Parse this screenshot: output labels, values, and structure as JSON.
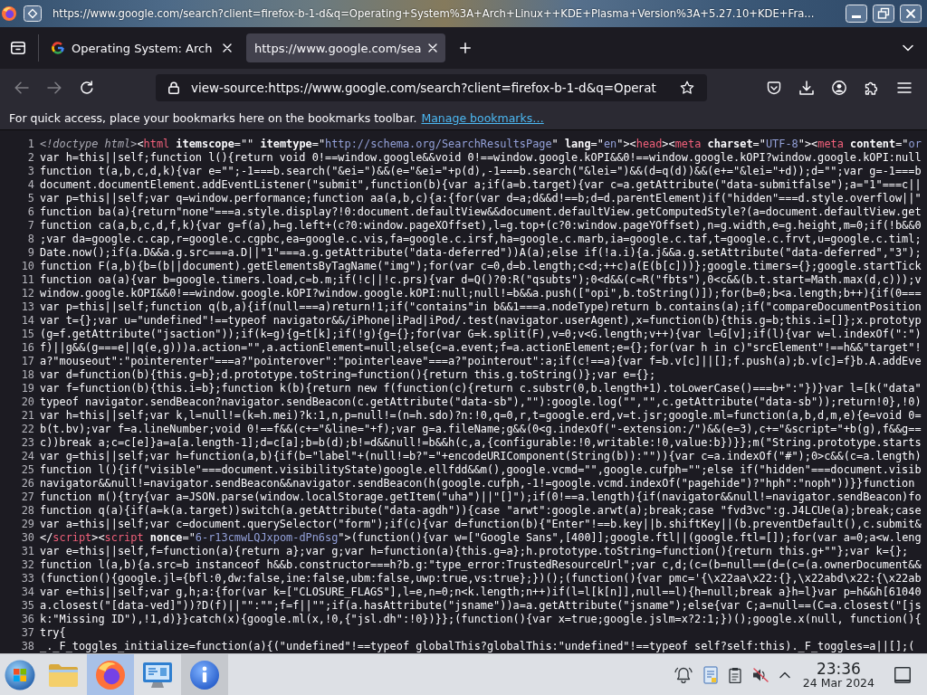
{
  "window": {
    "title": "https://www.google.com/search?client=firefox-b-1-d&q=Operating+System%3A+Arch+Linux++KDE+Plasma+Version%3A+5.27.10+KDE+Fra..."
  },
  "tabs": [
    {
      "label": "Operating System: Arch",
      "favicon": true,
      "selected": false
    },
    {
      "label": "https://www.google.com/sea",
      "favicon": false,
      "selected": true
    }
  ],
  "nav_buttons": [
    {
      "kind": "back",
      "disabled": true
    },
    {
      "kind": "forward",
      "disabled": true
    },
    {
      "kind": "reload",
      "disabled": false
    }
  ],
  "address_bar": {
    "value": "view-source:https://www.google.com/search?client=firefox-b-1-d&q=Operat"
  },
  "bookmarks_bar": {
    "message": "For quick access, place your bookmarks here on the bookmarks toolbar.",
    "link": "Manage bookmarks…"
  },
  "source": {
    "lines": [
      {
        "number": "1",
        "tokens": [
          {
            "kind": "doctype",
            "text": "<!doctype html>"
          },
          {
            "kind": "text",
            "text": "<"
          },
          {
            "kind": "tag",
            "text": "html"
          },
          {
            "kind": "attr",
            "text": " itemscope"
          },
          {
            "kind": "text",
            "text": "=\"\" "
          },
          {
            "kind": "attr",
            "text": "itemtype"
          },
          {
            "kind": "text",
            "text": "=\""
          },
          {
            "kind": "value",
            "text": "http://schema.org/SearchResultsPage"
          },
          {
            "kind": "text",
            "text": "\" "
          },
          {
            "kind": "attr",
            "text": "lang"
          },
          {
            "kind": "text",
            "text": "=\""
          },
          {
            "kind": "value",
            "text": "en"
          },
          {
            "kind": "text",
            "text": "\"><"
          },
          {
            "kind": "tag",
            "text": "head"
          },
          {
            "kind": "text",
            "text": "><"
          },
          {
            "kind": "tag",
            "text": "meta"
          },
          {
            "kind": "attr",
            "text": " charset"
          },
          {
            "kind": "text",
            "text": "=\""
          },
          {
            "kind": "value",
            "text": "UTF-8"
          },
          {
            "kind": "text",
            "text": "\"><"
          },
          {
            "kind": "tag",
            "text": "meta"
          },
          {
            "kind": "attr",
            "text": " content"
          },
          {
            "kind": "text",
            "text": "=\""
          },
          {
            "kind": "value",
            "text": "or"
          }
        ]
      },
      {
        "number": "2",
        "tokens": [
          {
            "kind": "text",
            "text": "var h=this||self;function l(){return void 0!==window.google&&void 0!==window.google.kOPI&&0!==window.google.kOPI?window.google.kOPI:null"
          }
        ]
      },
      {
        "number": "3",
        "tokens": [
          {
            "kind": "text",
            "text": "function t(a,b,c,d,k){var e=\"\";-1===b.search(\"&ei=\")&&(e=\"&ei=\"+p(d),-1===b.search(\"&lei=\")&&(d=q(d))&&(e+=\"&lei=\"+d));d=\"\";var g=-1===b"
          }
        ]
      },
      {
        "number": "4",
        "tokens": [
          {
            "kind": "text",
            "text": "document.documentElement.addEventListener(\"submit\",function(b){var a;if(a=b.target){var c=a.getAttribute(\"data-submitfalse\");a=\"1\"===c||"
          }
        ]
      },
      {
        "number": "5",
        "tokens": [
          {
            "kind": "text",
            "text": "var p=this||self;var q=window.performance;function aa(a,b,c){a:{for(var d=a;d&&d!==b;d=d.parentElement)if(\"hidden\"===d.style.overflow||\""
          }
        ]
      },
      {
        "number": "6",
        "tokens": [
          {
            "kind": "text",
            "text": "function ba(a){return\"none\"===a.style.display?!0:document.defaultView&&document.defaultView.getComputedStyle?(a=document.defaultView.get"
          }
        ]
      },
      {
        "number": "7",
        "tokens": [
          {
            "kind": "text",
            "text": "function ca(a,b,c,d,f,k){var g=f(a),h=g.left+(c?0:window.pageXOffset),l=g.top+(c?0:window.pageYOffset),n=g.width,e=g.height,m=0;if(!b&&0"
          }
        ]
      },
      {
        "number": "8",
        "tokens": [
          {
            "kind": "text",
            "text": ";var da=google.c.cap,r=google.c.cgpbc,ea=google.c.vis,fa=google.c.irsf,ha=google.c.marb,ia=google.c.taf,t=google.c.frvt,u=google.c.timl;"
          }
        ]
      },
      {
        "number": "9",
        "tokens": [
          {
            "kind": "text",
            "text": "Date.now();if(a.D&&a.g.src===a.D||\"1\"===a.g.getAttribute(\"data-deferred\"))A(a);else if(!a.i){a.j&&a.g.setAttribute(\"data-deferred\",\"3\");"
          }
        ]
      },
      {
        "number": "10",
        "tokens": [
          {
            "kind": "text",
            "text": "function F(a,b){b=(b||document).getElementsByTagName(\"img\");for(var c=0,d=b.length;c<d;++c)a(E(b[c]))};google.timers={};google.startTick"
          }
        ]
      },
      {
        "number": "11",
        "tokens": [
          {
            "kind": "text",
            "text": "function oa(a){var b=google.timers.load,c=b.m;if(!c||!c.prs){var d=Q()?0:R(\"qsubts\");0<d&&(c=R(\"fbts\"),0<c&&(b.t.start=Math.max(d,c)));v"
          }
        ]
      },
      {
        "number": "12",
        "tokens": [
          {
            "kind": "text",
            "text": "window.google.kOPI&&0!==window.google.kOPI?window.google.kOPI:null;null!=b&&a.push([\"opi\",b.toString()]);for(b=0;b<a.length;b++){if(0==="
          }
        ]
      },
      {
        "number": "13",
        "tokens": [
          {
            "kind": "text",
            "text": "var p=this||self;function q(b,a){if(null===a)return!1;if(\"contains\"in b&&1===a.nodeType)return b.contains(a);if(\"compareDocumentPosition"
          }
        ]
      },
      {
        "number": "14",
        "tokens": [
          {
            "kind": "text",
            "text": "var t={};var u=\"undefined\"!==typeof navigator&&/iPhone|iPad|iPod/.test(navigator.userAgent),x=function(b){this.g=b;this.i=[]};x.prototyp"
          }
        ]
      },
      {
        "number": "15",
        "tokens": [
          {
            "kind": "text",
            "text": "(g=f.getAttribute(\"jsaction\"));if(k=g){g=t[k];if(!g){g={};for(var G=k.split(F),v=0;v<G.length;v++){var l=G[v];if(l){var w=l.indexOf(\":\")"
          }
        ]
      },
      {
        "number": "16",
        "tokens": [
          {
            "kind": "text",
            "text": "f)||g&&(g===e||q(e,g)))a.action=\"\",a.actionElement=null;else{c=a.event;f=a.actionElement;e={};for(var h in c)\"srcElement\"!==h&&\"target\"!"
          }
        ]
      },
      {
        "number": "17",
        "tokens": [
          {
            "kind": "text",
            "text": "a?\"mouseout\":\"pointerenter\"===a?\"pointerover\":\"pointerleave\"===a?\"pointerout\":a;if(c!==a){var f=b.v[c]||[];f.push(a);b.v[c]=f}b.A.addEve"
          }
        ]
      },
      {
        "number": "18",
        "tokens": [
          {
            "kind": "text",
            "text": "var d=function(b){this.g=b};d.prototype.toString=function(){return this.g.toString()};var e={};"
          }
        ]
      },
      {
        "number": "19",
        "tokens": [
          {
            "kind": "text",
            "text": "var f=function(b){this.i=b};function k(b){return new f(function(c){return c.substr(0,b.length+1).toLowerCase()===b+\":\"})}var l=[k(\"data\""
          }
        ]
      },
      {
        "number": "20",
        "tokens": [
          {
            "kind": "text",
            "text": "typeof navigator.sendBeacon?navigator.sendBeacon(c.getAttribute(\"data-sb\"),\"\"):google.log(\"\",\"\",c.getAttribute(\"data-sb\"));return!0},!0)"
          }
        ]
      },
      {
        "number": "21",
        "tokens": [
          {
            "kind": "text",
            "text": "var h=this||self;var k,l=null!=(k=h.mei)?k:1,n,p=null!=(n=h.sdo)?n:!0,q=0,r,t=google.erd,v=t.jsr;google.ml=function(a,b,d,m,e){e=void 0="
          }
        ]
      },
      {
        "number": "22",
        "tokens": [
          {
            "kind": "text",
            "text": "b(t.bv);var f=a.lineNumber;void 0!==f&&(c+=\"&line=\"+f);var g=a.fileName;g&&(0<g.indexOf(\"-extension:/\")&&(e=3),c+=\"&script=\"+b(g),f&&g=="
          }
        ]
      },
      {
        "number": "23",
        "tokens": [
          {
            "kind": "text",
            "text": "c))break a;c=c[e]}a=a[a.length-1];d=c[a];b=b(d);b!=d&&null!=b&&h(c,a,{configurable:!0,writable:!0,value:b})}};m(\"String.prototype.starts"
          }
        ]
      },
      {
        "number": "24",
        "tokens": [
          {
            "kind": "text",
            "text": "var g=this||self;var h=function(a,b){if(b=\"label\"+(null!=b?\"=\"+encodeURIComponent(String(b)):\"\")){var c=a.indexOf(\"#\");0>c&&(c=a.length)"
          }
        ]
      },
      {
        "number": "25",
        "tokens": [
          {
            "kind": "text",
            "text": "function l(){if(\"visible\"===document.visibilityState)google.ellfdd&&m(),google.vcmd=\"\",google.cufph=\"\";else if(\"hidden\"===document.visib"
          }
        ]
      },
      {
        "number": "26",
        "tokens": [
          {
            "kind": "text",
            "text": "navigator&&null!=navigator.sendBeacon&&navigator.sendBeacon(h(google.cufph,-1!=google.vcmd.indexOf(\"pagehide\")?\"hph\":\"noph\"))}}function"
          }
        ]
      },
      {
        "number": "27",
        "tokens": [
          {
            "kind": "text",
            "text": "function m(){try{var a=JSON.parse(window.localStorage.getItem(\"uha\")||\"[]\");if(0!==a.length){if(navigator&&null!=navigator.sendBeacon)fo"
          }
        ]
      },
      {
        "number": "28",
        "tokens": [
          {
            "kind": "text",
            "text": "function q(a){if(a=k(a.target))switch(a.getAttribute(\"data-agdh\")){case \"arwt\":google.arwt(a);break;case \"fvd3vc\":g.J4LCUe(a);break;case"
          }
        ]
      },
      {
        "number": "29",
        "tokens": [
          {
            "kind": "text",
            "text": "var a=this||self;var c=document.querySelector(\"form\");if(c){var d=function(b){\"Enter\"!==b.key||b.shiftKey||(b.preventDefault(),c.submit&"
          }
        ]
      },
      {
        "number": "30",
        "tokens": [
          {
            "kind": "text",
            "text": "</"
          },
          {
            "kind": "tag",
            "text": "script"
          },
          {
            "kind": "text",
            "text": "><"
          },
          {
            "kind": "tag",
            "text": "script"
          },
          {
            "kind": "attr",
            "text": " nonce"
          },
          {
            "kind": "text",
            "text": "=\""
          },
          {
            "kind": "value",
            "text": "6-r13cmwLQJxpom-dPn6sg"
          },
          {
            "kind": "text",
            "text": "\">(function(){var w=[\"Google Sans\",[400]];google.ftl||(google.ftl=[]);for(var a=0;a<w.leng"
          }
        ]
      },
      {
        "number": "31",
        "tokens": [
          {
            "kind": "text",
            "text": "var e=this||self,f=function(a){return a};var g;var h=function(a){this.g=a};h.prototype.toString=function(){return this.g+\"\"};var k={};"
          }
        ]
      },
      {
        "number": "32",
        "tokens": [
          {
            "kind": "text",
            "text": "function l(a,b){a.src=b instanceof h&&b.constructor===h?b.g:\"type_error:TrustedResourceUrl\";var c,d;(c=(b=null==(d=(c=(a.ownerDocument&&"
          }
        ]
      },
      {
        "number": "33",
        "tokens": [
          {
            "kind": "text",
            "text": "(function(){google.jl={bfl:0,dw:false,ine:false,ubm:false,uwp:true,vs:true};})();(function(){var pmc='{\\x22aa\\x22:{},\\x22abd\\x22:{\\x22ab"
          }
        ]
      },
      {
        "number": "34",
        "tokens": [
          {
            "kind": "text",
            "text": "var e=this||self;var g,h;a:{for(var k=[\"CLOSURE_FLAGS\"],l=e,n=0;n<k.length;n++)if(l=l[k[n]],null==l){h=null;break a}h=l}var p=h&&h[61040"
          }
        ]
      },
      {
        "number": "35",
        "tokens": [
          {
            "kind": "text",
            "text": "a.closest(\"[data-ved]\"))?D(f)||\"\":\"\";f=f||\"\";if(a.hasAttribute(\"jsname\"))a=a.getAttribute(\"jsname\");else{var C;a=null==(C=a.closest(\"[js"
          }
        ]
      },
      {
        "number": "36",
        "tokens": [
          {
            "kind": "text",
            "text": "k:\"Missing ID\"),!1,d)}}catch(x){google.ml(x,!0,{\"jsl.dh\":!0})}};(function(){var x=true;google.jslm=x?2:1;})();google.x(null, function(){"
          }
        ]
      },
      {
        "number": "37",
        "tokens": [
          {
            "kind": "text",
            "text": "try{"
          }
        ]
      },
      {
        "number": "38",
        "tokens": [
          {
            "kind": "text",
            "text": "_._F_toggles_initialize=function(a){(\"undefined\"!==typeof globalThis?globalThis:\"undefined\"!==typeof self?self:this)._F_toggles=a||[];("
          }
        ]
      }
    ]
  },
  "taskbar": {
    "apps": [
      {
        "kind": "start",
        "running": false,
        "selected": false
      },
      {
        "kind": "files",
        "running": false,
        "selected": false
      },
      {
        "kind": "browser",
        "running": true,
        "selected": true
      },
      {
        "kind": "settings",
        "running": false,
        "selected": false
      },
      {
        "kind": "info",
        "running": true,
        "selected": false
      }
    ],
    "tray": [
      {
        "kind": "notifications"
      },
      {
        "kind": "notes"
      },
      {
        "kind": "clipboard"
      },
      {
        "kind": "volume_muted"
      },
      {
        "kind": "expand"
      }
    ],
    "clock": {
      "time": "23:36",
      "date": "24 Mar 2024"
    }
  }
}
